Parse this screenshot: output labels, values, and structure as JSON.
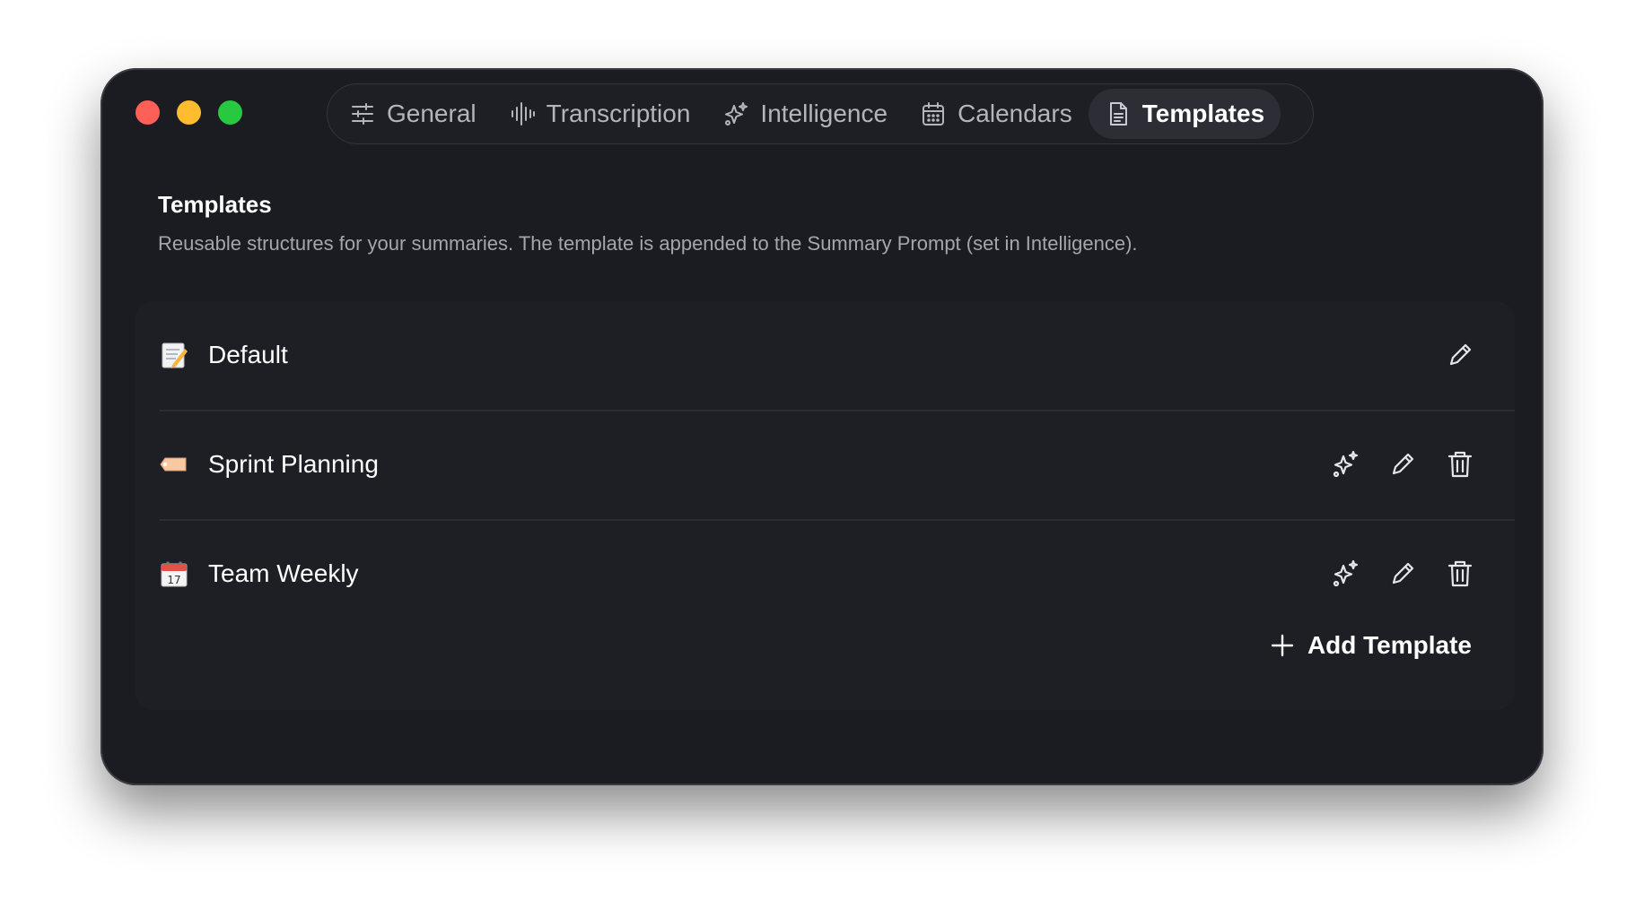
{
  "window": {
    "traffic_lights": [
      "close",
      "minimize",
      "zoom"
    ]
  },
  "tabs": [
    {
      "label": "General",
      "icon": "sliders-icon",
      "active": false
    },
    {
      "label": "Transcription",
      "icon": "waveform-icon",
      "active": false
    },
    {
      "label": "Intelligence",
      "icon": "sparkles-icon",
      "active": false
    },
    {
      "label": "Calendars",
      "icon": "calendar-icon",
      "active": false
    },
    {
      "label": "Templates",
      "icon": "document-icon",
      "active": true
    }
  ],
  "section": {
    "title": "Templates",
    "description": "Reusable structures for your summaries. The template is appended to the Summary Prompt (set in Intelligence)."
  },
  "templates": [
    {
      "label": "Default",
      "emoji": "memo-emoji",
      "actions": [
        "edit"
      ]
    },
    {
      "label": "Sprint Planning",
      "emoji": "label-tag-emoji",
      "actions": [
        "ai-generate",
        "edit",
        "delete"
      ]
    },
    {
      "label": "Team Weekly",
      "emoji": "calendar-emoji",
      "actions": [
        "ai-generate",
        "edit",
        "delete"
      ]
    }
  ],
  "add_button": {
    "label": "Add Template"
  },
  "colors": {
    "window_bg": "#1b1c22",
    "card_bg": "#1e1f25",
    "active_tab_bg": "#2d2e35",
    "muted_text": "#a4a6ae"
  }
}
